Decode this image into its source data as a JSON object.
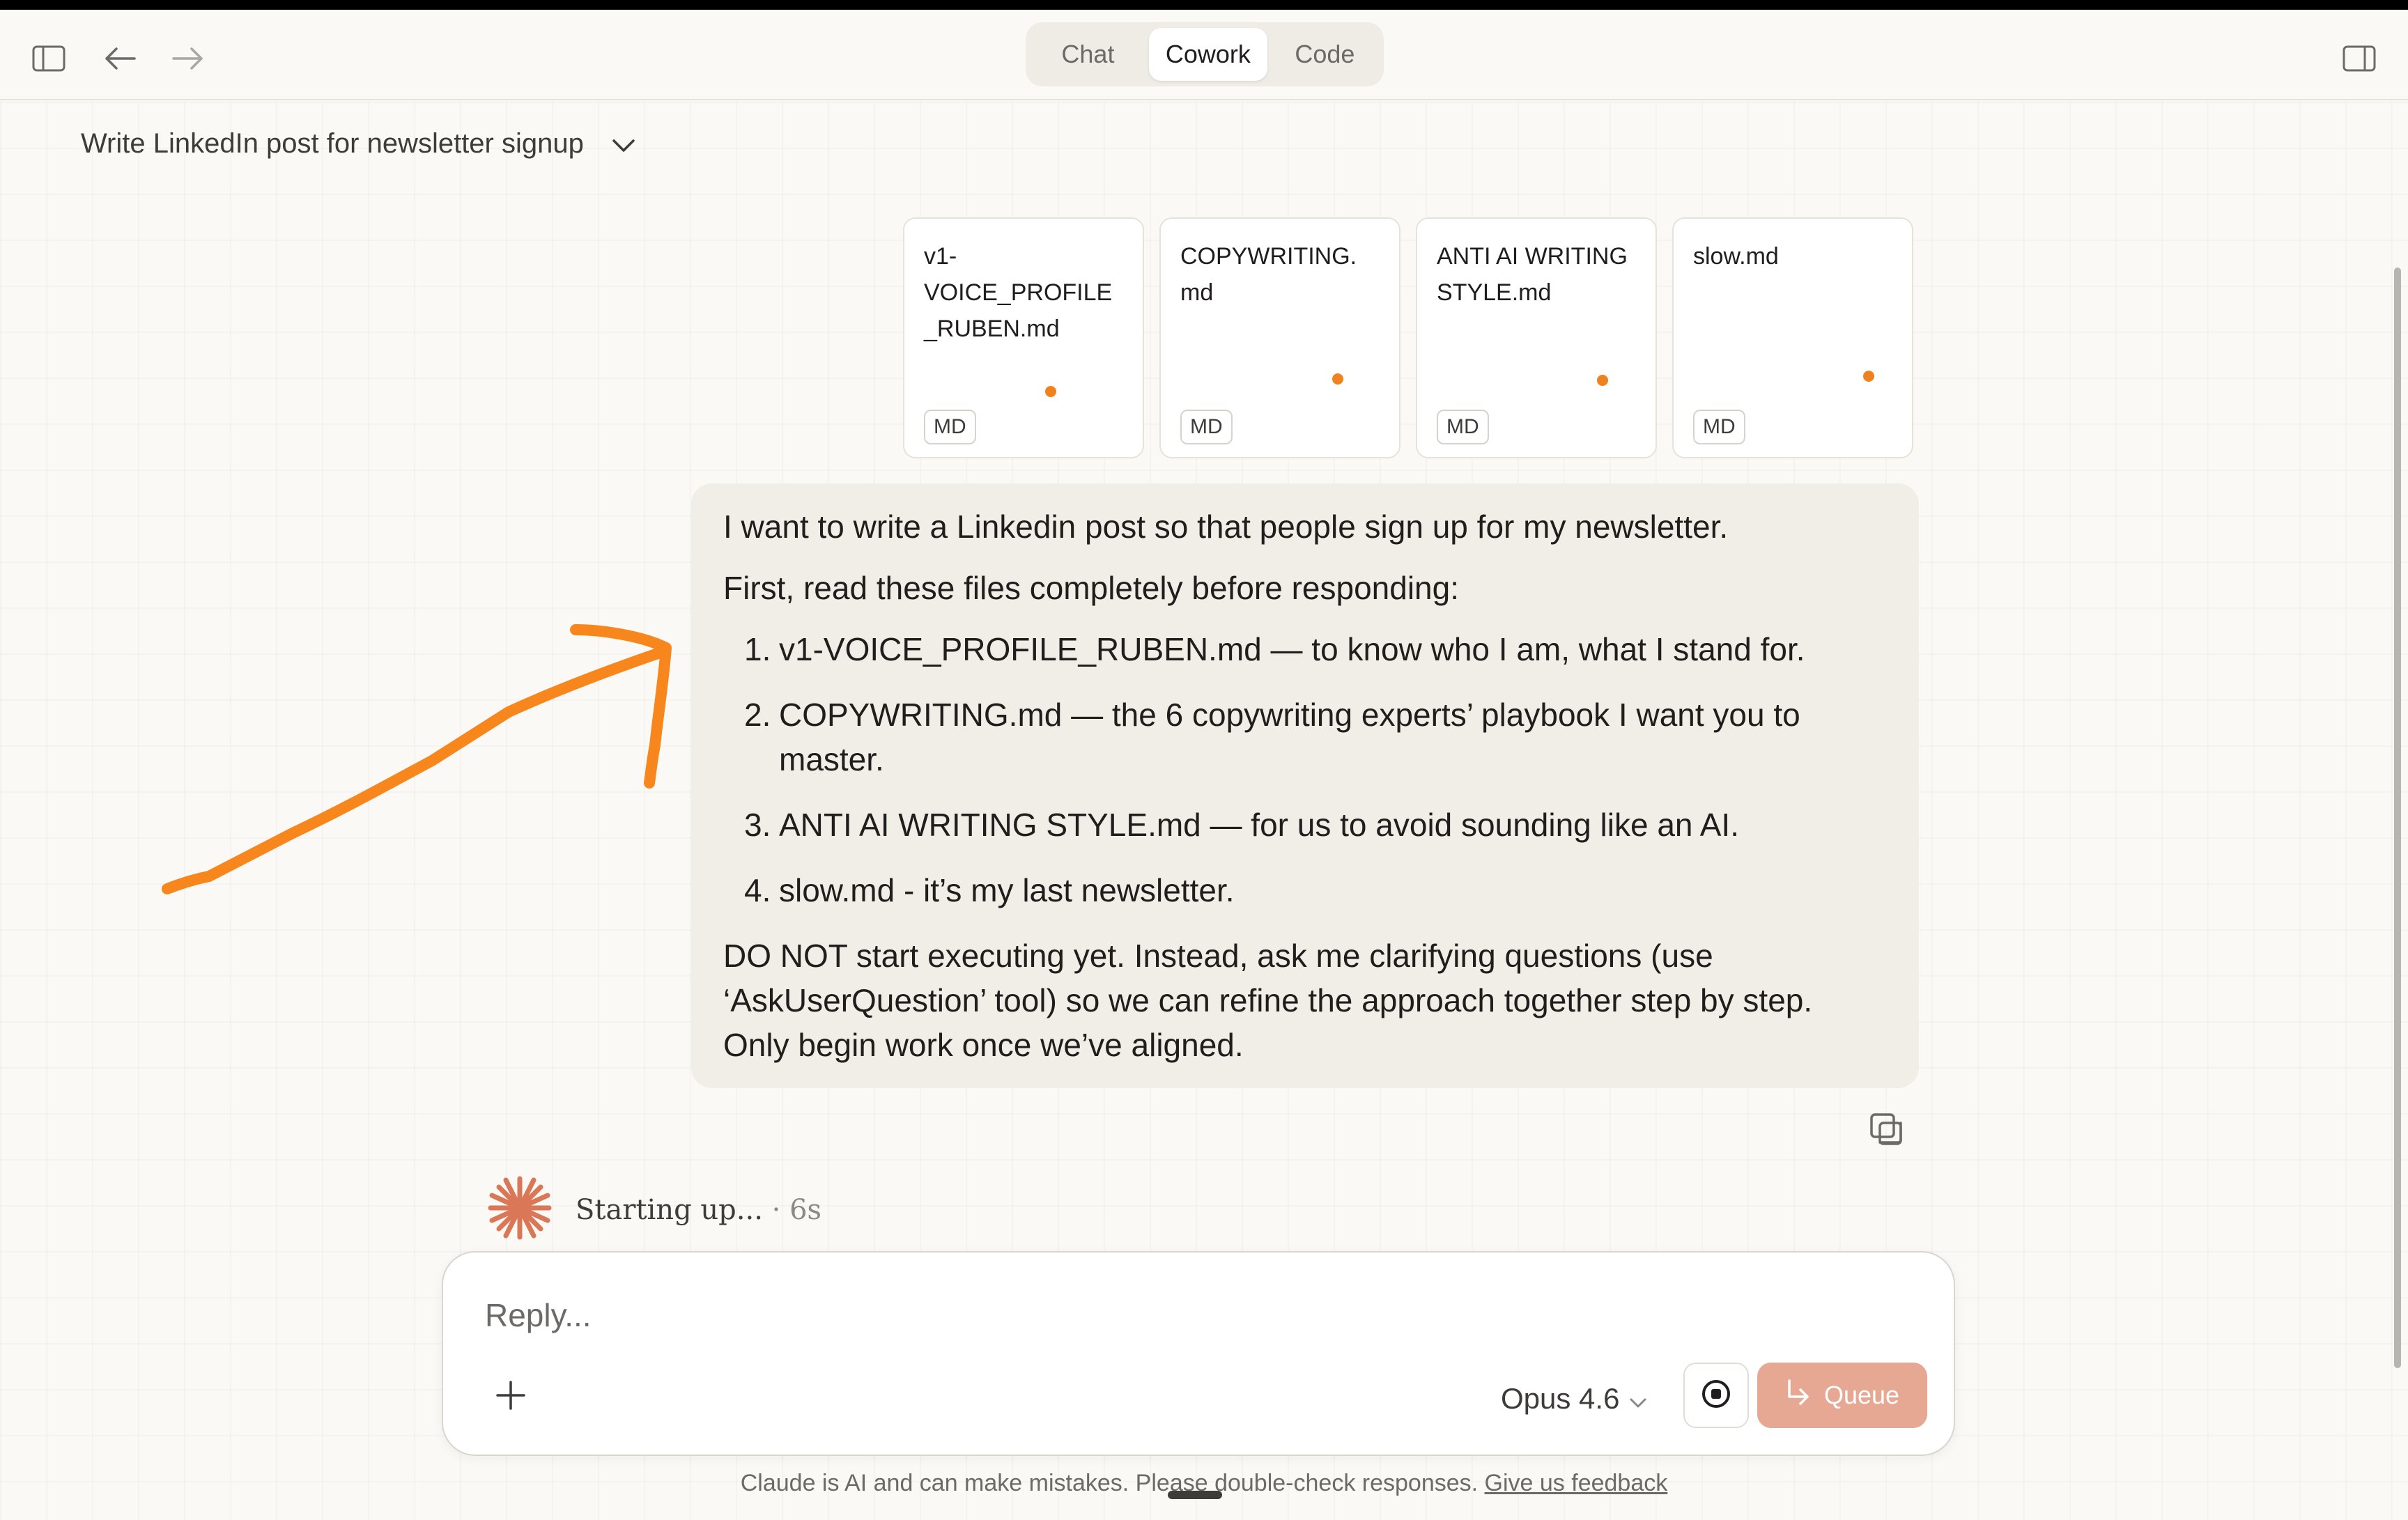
{
  "window": {
    "mode_tabs": [
      {
        "label": "Chat",
        "active": false
      },
      {
        "label": "Cowork",
        "active": true
      },
      {
        "label": "Code",
        "active": false
      }
    ]
  },
  "conversation": {
    "title": "Write LinkedIn post for newsletter signup"
  },
  "attachments": [
    {
      "name": "v1-\nVOICE_PROFILE\n_RUBEN.md",
      "type": "MD"
    },
    {
      "name": "COPYWRITING.\nmd",
      "type": "MD"
    },
    {
      "name": "ANTI AI WRITING\nSTYLE.md",
      "type": "MD"
    },
    {
      "name": "slow.md",
      "type": "MD"
    }
  ],
  "message": {
    "intro": "I want to write a Linkedin post so that people sign up for my newsletter.",
    "instruction": "First, read these files completely before responding:",
    "items": [
      {
        "num": "1.",
        "text": "v1-VOICE_PROFILE_RUBEN.md — to know who I am, what I stand for."
      },
      {
        "num": "2.",
        "text": "COPYWRITING.md — the 6 copywriting experts’ playbook I want you to master."
      },
      {
        "num": "3.",
        "text": "ANTI AI WRITING STYLE.md — for us to avoid sounding like an AI."
      },
      {
        "num": "4.",
        "text": "slow.md - it’s my last newsletter."
      }
    ],
    "closing": "DO NOT start executing yet. Instead, ask me clarifying questions (use ‘AskUserQuestion’ tool) so we can refine the approach together step by step. Only begin work once we’ve aligned."
  },
  "status": {
    "text": "Starting up...",
    "separator": " · ",
    "elapsed": "6s"
  },
  "composer": {
    "placeholder": "Reply...",
    "model": "Opus 4.6",
    "queue_label": "Queue"
  },
  "footer": {
    "disclaimer": "Claude is AI and can make mistakes. Please double-check responses.",
    "feedback_link": "Give us feedback"
  },
  "colors": {
    "accent": "#d97757",
    "annotation_arrow": "#f7861d",
    "attachment_dot": "#f0821e",
    "queue_button": "#e6a793",
    "message_bubble": "#f0eee6",
    "background": "#faf9f5"
  },
  "icons": {
    "sidebar_toggle": "sidebar-left-icon",
    "back": "arrow-left-icon",
    "forward": "arrow-right-icon",
    "panel_toggle": "sidebar-right-icon",
    "title_dropdown": "chevron-down-icon",
    "copy": "copy-icon",
    "status": "claude-spark-icon",
    "add": "plus-icon",
    "model_dropdown": "chevron-down-icon",
    "stop": "stop-record-icon",
    "queue": "enter-arrow-icon"
  }
}
